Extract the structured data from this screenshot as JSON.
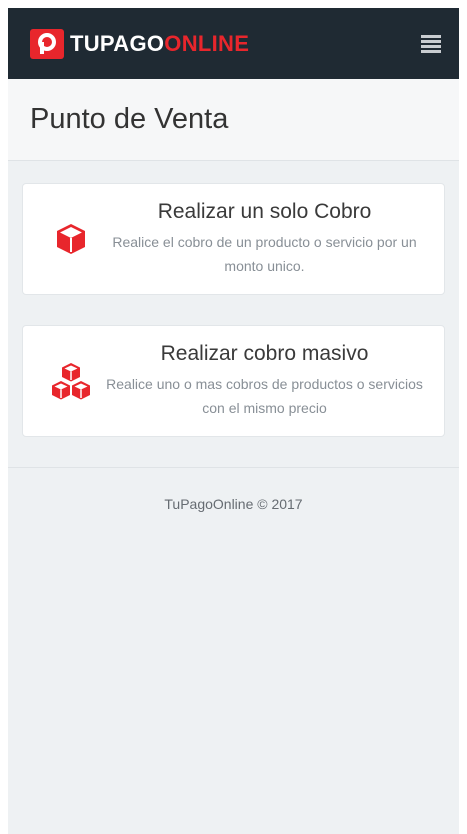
{
  "brand": {
    "logo_glyph": "P",
    "name_part1": "TUPAGO",
    "name_part2": "ONLINE",
    "primary_color": "#e8262c",
    "nav_bg": "#1f2a33"
  },
  "nav": {
    "menu_icon": "hamburger-icon"
  },
  "header": {
    "title": "Punto de Venta"
  },
  "cards": [
    {
      "icon": "cube-icon",
      "title": "Realizar un solo Cobro",
      "description": "Realice el cobro de un producto o servicio por un monto unico."
    },
    {
      "icon": "cubes-icon",
      "title": "Realizar cobro masivo",
      "description": "Realice uno o mas cobros de productos o servicios con el mismo precio"
    }
  ],
  "footer": {
    "text": "TuPagoOnline © 2017"
  }
}
